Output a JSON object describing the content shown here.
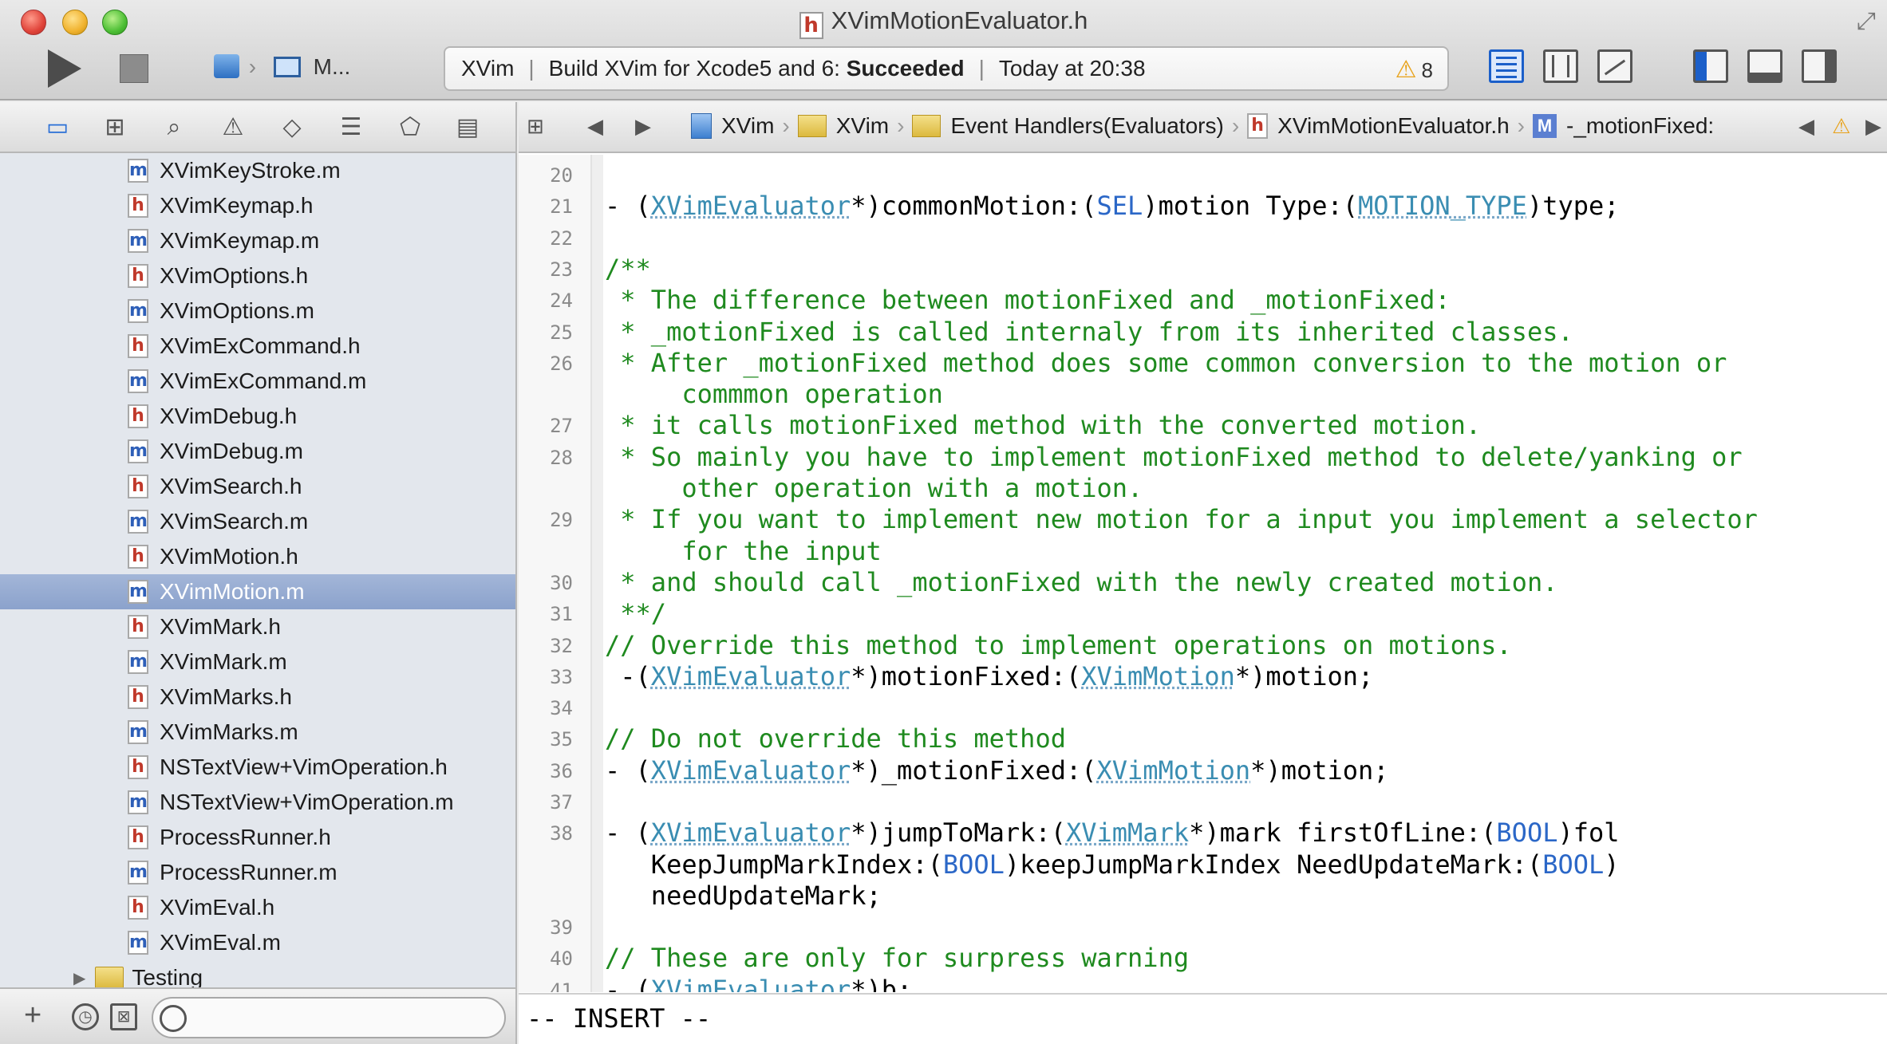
{
  "window": {
    "title": "XVimMotionEvaluator.h",
    "title_file_type": "h"
  },
  "toolbar": {
    "scheme_label": "M...",
    "activity": {
      "project": "XVim",
      "build_prefix": "Build XVim for Xcode5 and 6:",
      "build_status": "Succeeded",
      "time": "Today at 20:38",
      "warning_count": "8"
    }
  },
  "navigator": {
    "selected_index": 12,
    "files": [
      {
        "name": "XVimKeyStroke.m",
        "type": "m"
      },
      {
        "name": "XVimKeymap.h",
        "type": "h"
      },
      {
        "name": "XVimKeymap.m",
        "type": "m"
      },
      {
        "name": "XVimOptions.h",
        "type": "h"
      },
      {
        "name": "XVimOptions.m",
        "type": "m"
      },
      {
        "name": "XVimExCommand.h",
        "type": "h"
      },
      {
        "name": "XVimExCommand.m",
        "type": "m"
      },
      {
        "name": "XVimDebug.h",
        "type": "h"
      },
      {
        "name": "XVimDebug.m",
        "type": "m"
      },
      {
        "name": "XVimSearch.h",
        "type": "h"
      },
      {
        "name": "XVimSearch.m",
        "type": "m"
      },
      {
        "name": "XVimMotion.h",
        "type": "h"
      },
      {
        "name": "XVimMotion.m",
        "type": "m"
      },
      {
        "name": "XVimMark.h",
        "type": "h"
      },
      {
        "name": "XVimMark.m",
        "type": "m"
      },
      {
        "name": "XVimMarks.h",
        "type": "h"
      },
      {
        "name": "XVimMarks.m",
        "type": "m"
      },
      {
        "name": "NSTextView+VimOperation.h",
        "type": "h"
      },
      {
        "name": "NSTextView+VimOperation.m",
        "type": "m"
      },
      {
        "name": "ProcessRunner.h",
        "type": "h"
      },
      {
        "name": "ProcessRunner.m",
        "type": "m"
      },
      {
        "name": "XVimEval.h",
        "type": "h"
      },
      {
        "name": "XVimEval.m",
        "type": "m"
      }
    ],
    "folder": {
      "name": "Testing"
    },
    "footer": {
      "add_symbol": "+"
    }
  },
  "jump_bar": {
    "items": [
      "XVim",
      "XVim",
      "Event Handlers(Evaluators)",
      "XVimMotionEvaluator.h",
      "-_motionFixed:"
    ],
    "h_badge": "h",
    "m_badge": "M"
  },
  "editor": {
    "lines": [
      {
        "num": "20",
        "text": ""
      },
      {
        "num": "21",
        "text": "- (XVimEvaluator*)commonMotion:(SEL)motion Type:(MOTION_TYPE)type;"
      },
      {
        "num": "22",
        "text": ""
      },
      {
        "num": "23",
        "text": "/**"
      },
      {
        "num": "24",
        "text": " * The difference between motionFixed and _motionFixed:"
      },
      {
        "num": "25",
        "text": " * _motionFixed is called internaly from its inherited classes."
      },
      {
        "num": "26",
        "text": " * After _motionFixed method does some common conversion to the motion or"
      },
      {
        "num": "",
        "text": "     commmon operation"
      },
      {
        "num": "27",
        "text": " * it calls motionFixed method with the converted motion."
      },
      {
        "num": "28",
        "text": " * So mainly you have to implement motionFixed method to delete/yanking or"
      },
      {
        "num": "",
        "text": "     other operation with a motion."
      },
      {
        "num": "29",
        "text": " * If you want to implement new motion for a input you implement a selector"
      },
      {
        "num": "",
        "text": "     for the input"
      },
      {
        "num": "30",
        "text": " * and should call _motionFixed with the newly created motion."
      },
      {
        "num": "31",
        "text": " **/"
      },
      {
        "num": "32",
        "text": "// Override this method to implement operations on motions."
      },
      {
        "num": "33",
        "text": " -(XVimEvaluator*)motionFixed:(XVimMotion*)motion;"
      },
      {
        "num": "34",
        "text": ""
      },
      {
        "num": "35",
        "text": "// Do not override this method"
      },
      {
        "num": "36",
        "text": "- (XVimEvaluator*)_motionFixed:(XVimMotion*)motion;"
      },
      {
        "num": "37",
        "text": ""
      },
      {
        "num": "38",
        "text": "- (XVimEvaluator*)jumpToMark:(XVimMark*)mark firstOfLine:(BOOL)fol"
      },
      {
        "num": "",
        "text": "   KeepJumpMarkIndex:(BOOL)keepJumpMarkIndex NeedUpdateMark:(BOOL)"
      },
      {
        "num": "",
        "text": "   needUpdateMark;"
      },
      {
        "num": "39",
        "text": ""
      },
      {
        "num": "40",
        "text": "// These are only for surpress warning"
      },
      {
        "num": "41",
        "text": "- (XVimEvaluator*)b;"
      }
    ],
    "mode": "-- INSERT --"
  },
  "colors": {
    "comment": "#1f8a1f",
    "type": "#3a8db2",
    "keyword": "#2b67c7",
    "selection": "#8ba2cc",
    "warning": "#e8a21a"
  }
}
